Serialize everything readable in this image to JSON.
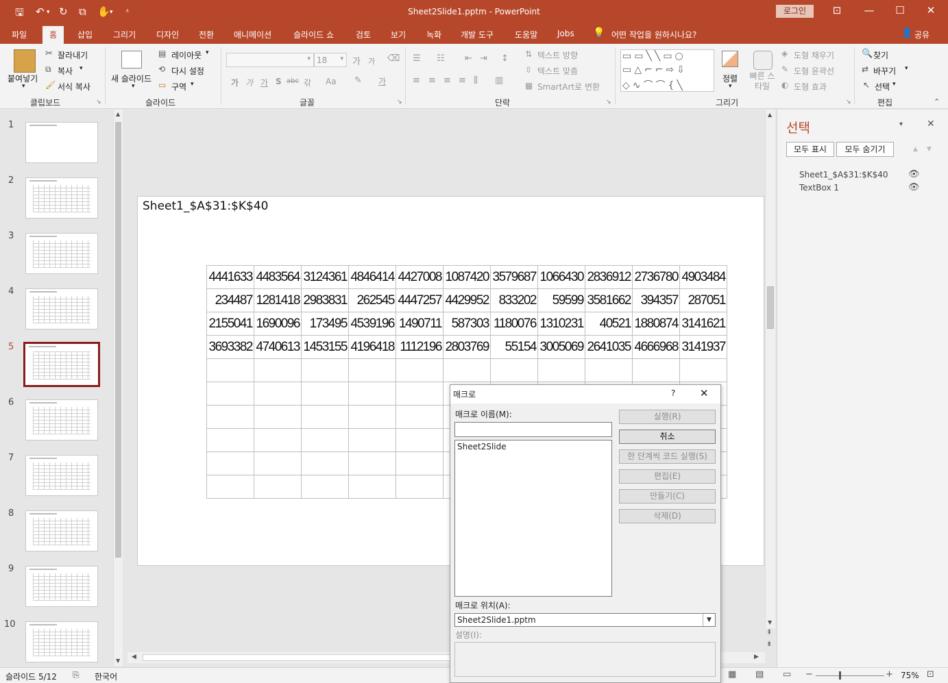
{
  "app": {
    "title": "Sheet2Slide1.pptm  -  PowerPoint",
    "login": "로그인",
    "share": "공유",
    "tell_me": "어떤 작업을 원하시나요?"
  },
  "tabs": [
    "파일",
    "홈",
    "삽입",
    "그리기",
    "디자인",
    "전환",
    "애니메이션",
    "슬라이드 쇼",
    "검토",
    "보기",
    "녹화",
    "개발 도구",
    "도움말",
    "Jobs"
  ],
  "ribbon": {
    "clipboard": {
      "paste": "붙여넣기",
      "cut": "잘라내기",
      "copy": "복사",
      "format_painter": "서식 복사",
      "label": "클립보드"
    },
    "slides": {
      "new_slide": "새 슬라이드",
      "layout": "레이아웃",
      "reset": "다시 설정",
      "section": "구역",
      "label": "슬라이드"
    },
    "font": {
      "font_size": "18",
      "label": "글꼴"
    },
    "paragraph": {
      "text_direction": "텍스트 방향",
      "align_text": "텍스트 맞춤",
      "smartart": "SmartArt로 변환",
      "label": "단락"
    },
    "drawing": {
      "arrange": "정렬",
      "quick_styles": "빠른 스타일",
      "shape_fill": "도형 채우기",
      "shape_outline": "도형 윤곽선",
      "shape_effects": "도형 효과",
      "label": "그리기"
    },
    "editing": {
      "find": "찾기",
      "replace": "바꾸기",
      "select": "선택",
      "label": "편집"
    }
  },
  "thumbnails": {
    "numbers": [
      "1",
      "2",
      "3",
      "4",
      "5",
      "6",
      "7",
      "8",
      "9",
      "10"
    ],
    "selected": "5"
  },
  "slide": {
    "title": "Sheet1_$A$31:$K$40",
    "rows": [
      [
        "4441633",
        "4483564",
        "3124361",
        "4846414",
        "4427008",
        "1087420",
        "3579687",
        "1066430",
        "2836912",
        "2736780",
        "4903484"
      ],
      [
        "234487",
        "1281418",
        "2983831",
        "262545",
        "4447257",
        "4429952",
        "833202",
        "59599",
        "3581662",
        "394357",
        "287051"
      ],
      [
        "2155041",
        "1690096",
        "173495",
        "4539196",
        "1490711",
        "587303",
        "1180076",
        "1310231",
        "40521",
        "1880874",
        "3141621"
      ],
      [
        "3693382",
        "4740613",
        "1453155",
        "4196418",
        "1112196",
        "2803769",
        "55154",
        "3005069",
        "2641035",
        "4666968",
        "3141937"
      ],
      [
        "",
        "",
        "",
        "",
        "",
        "",
        "",
        "",
        "",
        "",
        ""
      ],
      [
        "",
        "",
        "",
        "",
        "",
        "",
        "",
        "",
        "",
        "",
        ""
      ],
      [
        "",
        "",
        "",
        "",
        "",
        "",
        "",
        "",
        "",
        "",
        ""
      ],
      [
        "",
        "",
        "",
        "",
        "",
        "",
        "",
        "",
        "",
        "",
        ""
      ],
      [
        "",
        "",
        "",
        "",
        "",
        "",
        "",
        "",
        "",
        "",
        ""
      ],
      [
        "",
        "",
        "",
        "",
        "",
        "",
        "",
        "",
        "",
        "",
        ""
      ]
    ]
  },
  "selection_pane": {
    "title": "선택",
    "show_all": "모두 표시",
    "hide_all": "모두 숨기기",
    "items": [
      "Sheet1_$A$31:$K$40",
      "TextBox 1"
    ]
  },
  "macro_dialog": {
    "title": "매크로",
    "help": "?",
    "name_label": "매크로 이름(M):",
    "name_value": "",
    "macros": [
      "Sheet2Slide"
    ],
    "location_label": "매크로 위치(A):",
    "location_value": "Sheet2Slide1.pptm",
    "description_label": "설명(I):",
    "buttons": {
      "run": "실행(R)",
      "cancel": "취소",
      "step": "한 단계씩 코드 실행(S)",
      "edit": "편집(E)",
      "create": "만들기(C)",
      "delete": "삭제(D)"
    }
  },
  "status": {
    "slide": "슬라이드 5/12",
    "language": "한국어",
    "zoom": "75%"
  }
}
